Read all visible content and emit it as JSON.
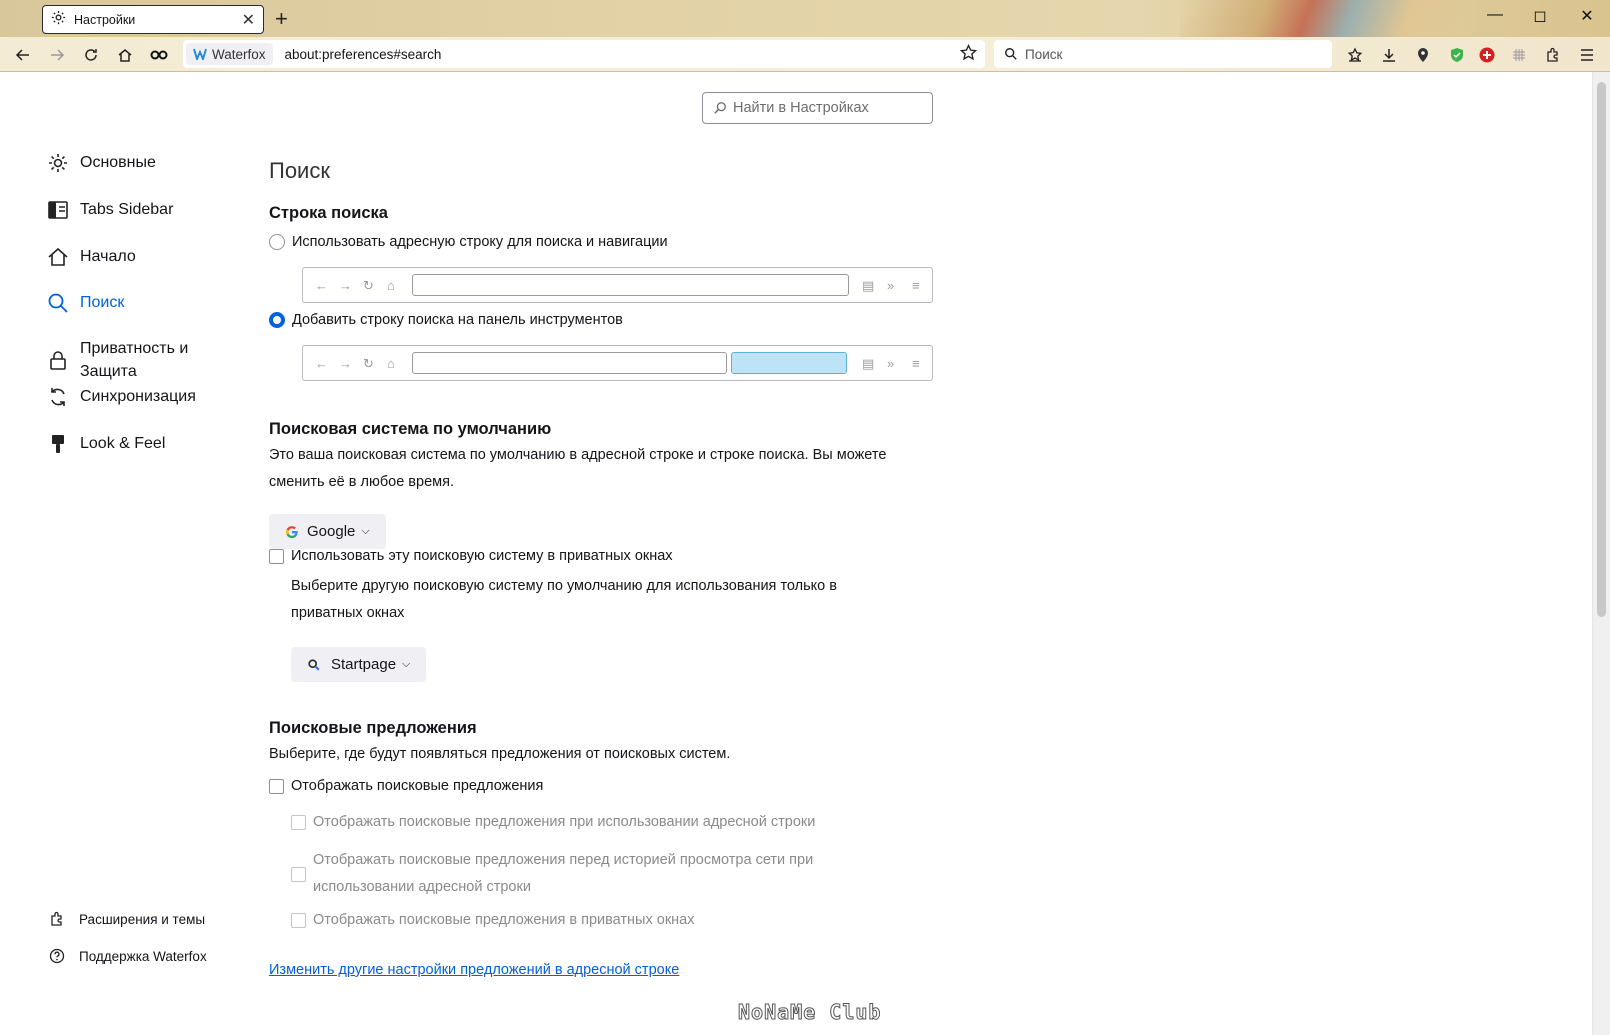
{
  "tab": {
    "title": "Настройки"
  },
  "toolbar": {
    "identity_label": "Waterfox",
    "url": "about:preferences#search",
    "search_placeholder": "Поиск"
  },
  "find": {
    "placeholder": "Найти в Настройках"
  },
  "sidebar": {
    "items": [
      {
        "label": "Основные"
      },
      {
        "label": "Tabs Sidebar"
      },
      {
        "label": "Начало"
      },
      {
        "label": "Поиск"
      },
      {
        "label": "Приватность и\nЗащита"
      },
      {
        "label": "Синхронизация"
      },
      {
        "label": "Look & Feel"
      }
    ],
    "footer": [
      {
        "label": "Расширения и темы"
      },
      {
        "label": "Поддержка Waterfox"
      }
    ]
  },
  "main": {
    "title": "Поиск",
    "searchbar_section": {
      "heading": "Строка поиска",
      "option_urlbar": "Использовать адресную строку для поиска и навигации",
      "option_toolbar": "Добавить строку поиска на панель инструментов"
    },
    "default_engine": {
      "heading": "Поисковая система по умолчанию",
      "description_line1": "Это ваша поисковая система по умолчанию в адресной строке и строке поиска. Вы можете",
      "description_line2": "сменить её в любое время.",
      "engine": "Google",
      "private_checkbox": "Использовать эту поисковую систему в приватных окнах",
      "private_desc_line1": "Выберите другую поисковую систему по умолчанию для использования только в",
      "private_desc_line2": "приватных окнах",
      "private_engine": "Startpage"
    },
    "suggestions": {
      "heading": "Поисковые предложения",
      "description": "Выберите, где будут появляться предложения от поисковых систем.",
      "show": "Отображать поисковые предложения",
      "in_urlbar": "Отображать поисковые предложения при использовании адресной строки",
      "before_history_line1": "Отображать поисковые предложения перед историей просмотра сети при",
      "before_history_line2": "использовании адресной строки",
      "in_private": "Отображать поисковые предложения в приватных окнах",
      "link": "Изменить другие настройки предложений в адресной строке"
    }
  },
  "watermark": "NoNaMe Club",
  "colors": {
    "accent": "#0061e0",
    "frame": "#e2d2a6"
  }
}
